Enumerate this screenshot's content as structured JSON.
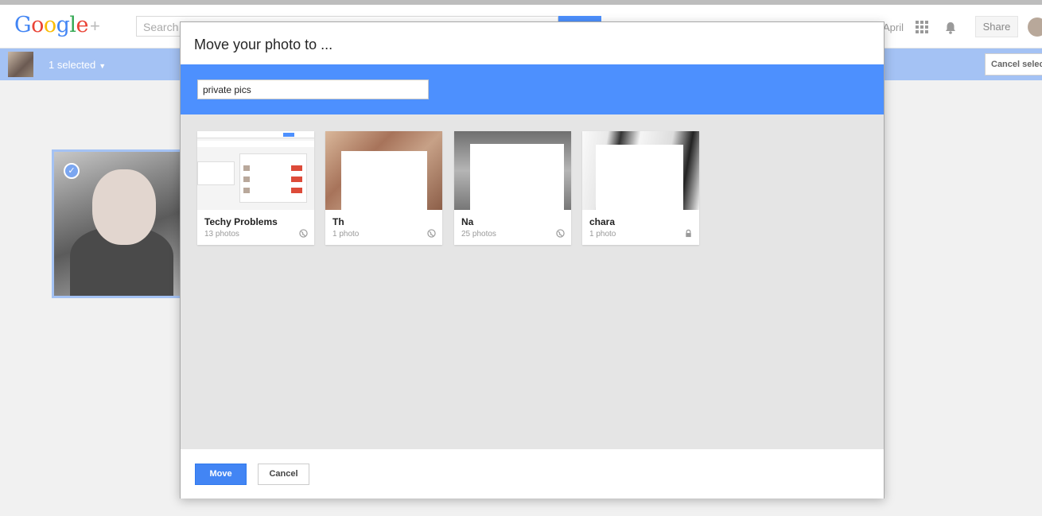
{
  "app": {
    "logo_text": "Google+",
    "search_placeholder": "Search",
    "user_name": "April",
    "share_label": "Share"
  },
  "selection_bar": {
    "count_label": "1 selected",
    "cancel_label": "Cancel selection"
  },
  "dialog": {
    "title": "Move your photo to ...",
    "album_input_value": "private pics",
    "albums": [
      {
        "name": "Techy Problems",
        "count": "13 photos",
        "visibility": "public",
        "icon": "globe-icon"
      },
      {
        "name": "Th",
        "count": "1 photo",
        "visibility": "public",
        "icon": "globe-icon"
      },
      {
        "name": "Na",
        "count": "25 photos",
        "visibility": "public",
        "icon": "globe-icon"
      },
      {
        "name": "chara",
        "count": "1 photo",
        "visibility": "private",
        "icon": "lock-icon"
      }
    ],
    "move_label": "Move",
    "cancel_label": "Cancel"
  },
  "colors": {
    "accent_blue": "#4d90fe",
    "selection_bar": "#a4c2f4",
    "move_button": "#4285f4",
    "dialog_body": "#e5e5e5"
  }
}
